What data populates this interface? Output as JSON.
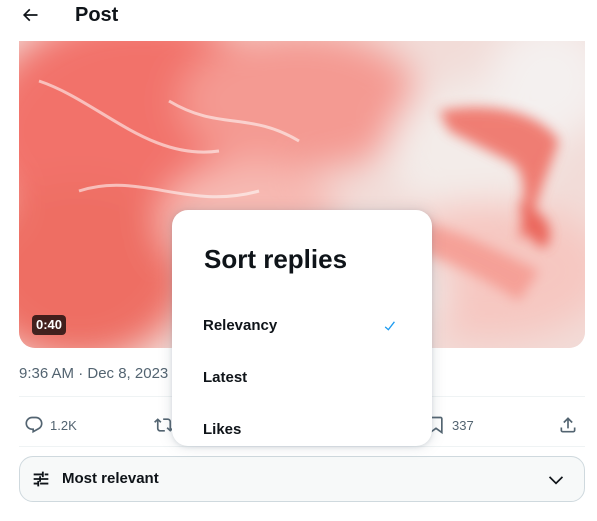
{
  "header": {
    "title": "Post",
    "back_icon": "arrow-left-icon"
  },
  "media": {
    "duration": "0:40"
  },
  "post": {
    "timestamp": "9:36 AM · Dec 8, 2023"
  },
  "actions": {
    "replies": "1.2K",
    "bookmarks": "337"
  },
  "sort_bar": {
    "label": "Most relevant",
    "icon": "filter-icon"
  },
  "sort_menu": {
    "title": "Sort replies",
    "options": [
      {
        "label": "Relevancy",
        "selected": true
      },
      {
        "label": "Latest",
        "selected": false
      },
      {
        "label": "Likes",
        "selected": false
      }
    ]
  },
  "colors": {
    "accent": "#1d9bf0",
    "text_primary": "#0f1419",
    "text_secondary": "#536471"
  }
}
